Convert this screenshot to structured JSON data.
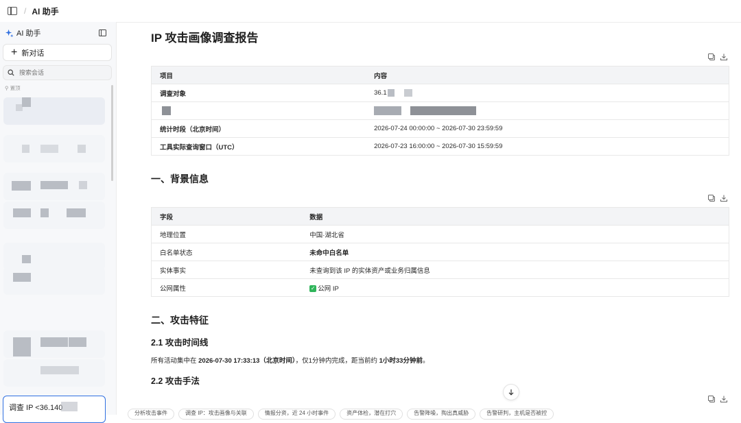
{
  "topbar": {
    "breadcrumb": "AI 助手"
  },
  "sidebar": {
    "title": "AI 助手",
    "new_chat": "新对话",
    "search_placeholder": "搜索会话",
    "pinned_label": "置顶",
    "current_conversation": "调查 IP <36.140"
  },
  "report": {
    "title": "IP 攻击画像调查报告",
    "table1": {
      "headers": [
        "项目",
        "内容"
      ],
      "rows": [
        {
          "k": "调查对象",
          "v": "36.1"
        },
        {
          "k": "",
          "v": ""
        },
        {
          "k": "统计时段（北京时间）",
          "v": "2026-07-24 00:00:00 ~ 2026-07-30 23:59:59"
        },
        {
          "k": "工具实际查询窗口（UTC）",
          "v": "2026-07-23 16:00:00 ~ 2026-07-30 15:59:59"
        }
      ]
    },
    "section1": "一、背景信息",
    "table2": {
      "headers": [
        "字段",
        "数据"
      ],
      "rows": [
        {
          "k": "地理位置",
          "v": "中国·湖北省"
        },
        {
          "k": "白名单状态",
          "v": "未命中白名单"
        },
        {
          "k": "实体事实",
          "v": "未查询到该 IP 的实体资产或业务归属信息"
        },
        {
          "k": "公网属性",
          "v": "公网 IP"
        }
      ]
    },
    "section2": "二、攻击特征",
    "sub21": "2.1 攻击时间线",
    "para": {
      "p1": "所有活动集中在 ",
      "p2": "2026-07-30 17:33:13（北京时间）",
      "p3": "，仅1分钟内完成，距当前约 ",
      "p4": "1小时33分钟前",
      "p5": "。"
    },
    "sub22": "2.2 攻击手法"
  },
  "chips": [
    "分析攻击事件",
    "调查 IP：攻击画像与关联",
    "情报分资，近 24 小时事件",
    "资产体检，潜在打穴",
    "告警降噪，掏出真威胁",
    "告警研判，主机是否被控"
  ]
}
